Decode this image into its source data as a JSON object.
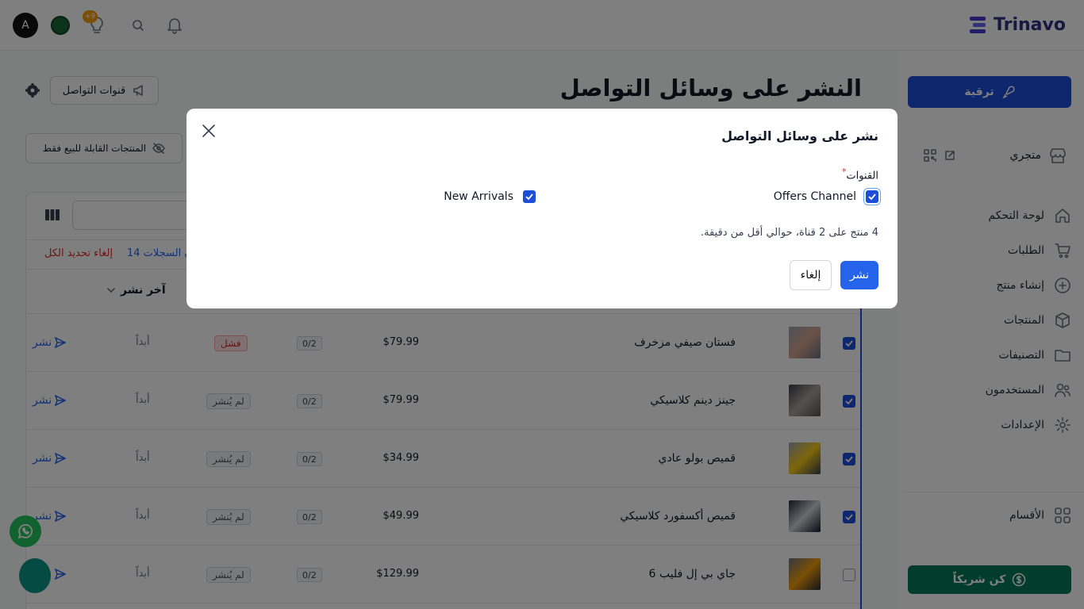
{
  "header": {
    "brand": "Trinavo",
    "avatar_letter": "A",
    "notifications_badge": "+9"
  },
  "sidebar": {
    "upgrade_label": "ترقية",
    "store_label": "متجري",
    "items": [
      {
        "label": "لوحة التحكم",
        "icon": "home-icon"
      },
      {
        "label": "الطلبات",
        "icon": "cart-icon"
      },
      {
        "label": "إنشاء منتج",
        "icon": "plus-circle-icon"
      },
      {
        "label": "المنتجات",
        "icon": "box-icon"
      },
      {
        "label": "التصنيفات",
        "icon": "folder-icon"
      },
      {
        "label": "المستخدمون",
        "icon": "users-icon"
      },
      {
        "label": "الإعدادات",
        "icon": "gear-icon"
      }
    ],
    "sections_label": "الأقسام",
    "partner_label": "كن شريكاً"
  },
  "main": {
    "title": "النشر على وسائل التواصل",
    "channels_button": "قنوات التواصل",
    "sellable_only_button": "المنتجات القابلة للبيع فقط",
    "records_count": "ن السجلات 14",
    "deselect_all": "إلغاء تحديد الكل",
    "last_post_header": "آخر نشر",
    "publish_label": "نشر",
    "rows": [
      {
        "name": "فستان صيفي مزخرف",
        "price": "$79.99",
        "channels": "0/2",
        "status": "فشل",
        "last": "أبداً",
        "checked": true
      },
      {
        "name": "جينز دينم كلاسيكي",
        "price": "$79.99",
        "channels": "0/2",
        "status": "لم يُنشر",
        "last": "أبداً",
        "checked": true
      },
      {
        "name": "قميص بولو عادي",
        "price": "$34.99",
        "channels": "0/2",
        "status": "لم يُنشر",
        "last": "أبداً",
        "checked": true
      },
      {
        "name": "قميص أكسفورد كلاسيكي",
        "price": "$49.99",
        "channels": "0/2",
        "status": "لم يُنشر",
        "last": "أبداً",
        "checked": true
      },
      {
        "name": "جاي بي إل فليب 6",
        "price": "$129.99",
        "channels": "0/2",
        "status": "لم يُنشر",
        "last": "أبداً",
        "checked": false
      }
    ]
  },
  "modal": {
    "title": "نشر على وسائل التواصل",
    "channels_label": "القنوات",
    "required_mark": "*",
    "channels": [
      {
        "name": "Offers Channel",
        "checked": true
      },
      {
        "name": "New Arrivals",
        "checked": true
      }
    ],
    "summary": "4 منتج على 2 قناة، حوالي أقل من دقيقة.",
    "publish_button": "نشر",
    "cancel_button": "إلغاء"
  },
  "colors": {
    "primary": "#2563eb",
    "upgrade": "#1d4ed8",
    "partner": "#047857",
    "danger": "#dc2626",
    "brand": "#312e81"
  }
}
